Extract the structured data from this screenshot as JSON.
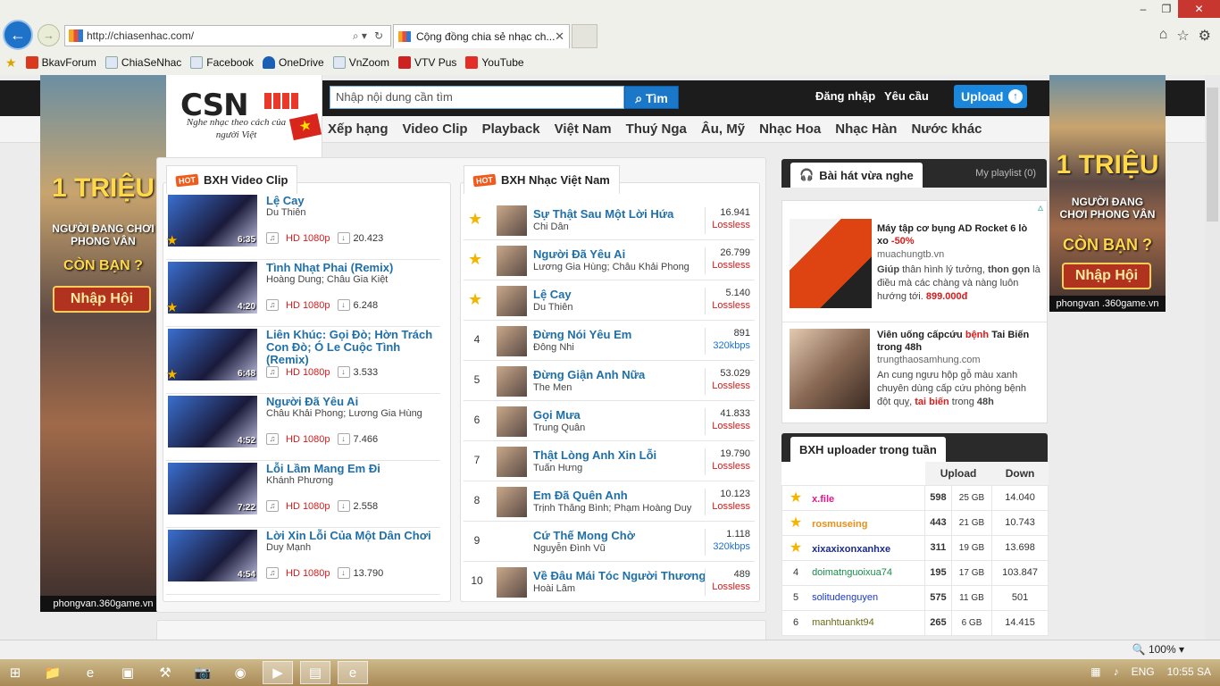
{
  "browser": {
    "url": "http://chiasenhac.com/",
    "tab_title": "Cộng đồng chia sẻ nhạc ch...",
    "favorites": [
      "BkavForum",
      "ChiaSeNhac",
      "Facebook",
      "OneDrive",
      "VnZoom",
      "VTV Pus",
      "YouTube"
    ],
    "zoom": "100%"
  },
  "site": {
    "logo": "CSN",
    "slogan": "Nghe nhạc theo cách của người Việt",
    "search_placeholder": "Nhập nội dung cần tìm",
    "search_button": "Tìm",
    "login": "Đăng nhập",
    "request": "Yêu cầu",
    "upload": "Upload",
    "menu": [
      "Xếp hạng",
      "Video Clip",
      "Playback",
      "Việt Nam",
      "Thuý Nga",
      "Âu, Mỹ",
      "Nhạc Hoa",
      "Nhạc Hàn",
      "Nước khác"
    ]
  },
  "ads": {
    "left": {
      "top": "1 TRIỆU",
      "mid": "NGƯỜI ĐANG CHƠI PHONG VÂN",
      "ask": "CÒN BẠN ?",
      "btn": "Nhập Hội",
      "foot": "phongvan.360game.vn"
    },
    "right": {
      "top": "1 TRIỆU",
      "mid": "NGƯỜI ĐANG CHƠI PHONG VÂN",
      "ask": "CÒN BẠN ?",
      "btn": "Nhập Hội",
      "foot": "phongvan .360game.vn"
    }
  },
  "video_chart": {
    "title": "BXH Video Clip",
    "hot": "HOT",
    "items": [
      {
        "title": "Lệ Cay",
        "artist": "Du Thiên",
        "duration": "6:35",
        "quality": "HD 1080p",
        "views": "20.423",
        "rank": "1"
      },
      {
        "title": "Tình Nhạt Phai (Remix)",
        "artist": "Hoàng Dung; Châu Gia Kiệt",
        "duration": "4:20",
        "quality": "HD 1080p",
        "views": "6.248",
        "rank": "2"
      },
      {
        "title": "Liên Khúc: Gọi Đò; Hờn Trách Con Đò; Ó Le Cuộc Tình (Remix)",
        "artist": "",
        "duration": "6:48",
        "quality": "HD 1080p",
        "views": "3.533",
        "rank": "3"
      },
      {
        "title": "Người Đã Yêu Ai",
        "artist": "Châu Khải Phong; Lương Gia Hùng",
        "duration": "4:52",
        "quality": "HD 1080p",
        "views": "7.466",
        "rank": ""
      },
      {
        "title": "Lỗi Lầm Mang Em Đi",
        "artist": "Khánh Phương",
        "duration": "7:22",
        "quality": "HD 1080p",
        "views": "2.558",
        "rank": ""
      },
      {
        "title": "Lời Xin Lỗi Của Một Dân Chơi",
        "artist": "Duy Mạnh",
        "duration": "4:54",
        "quality": "HD 1080p",
        "views": "13.790",
        "rank": ""
      }
    ]
  },
  "vn_chart": {
    "title": "BXH Nhạc Việt Nam",
    "hot": "HOT",
    "items": [
      {
        "rank": "1",
        "title": "Sự Thật Sau Một Lời Hứa",
        "artist": "Chi Dân",
        "count": "16.941",
        "quality": "Lossless"
      },
      {
        "rank": "2",
        "title": "Người Đã Yêu Ai",
        "artist": "Lương Gia Hùng; Châu Khải Phong",
        "count": "26.799",
        "quality": "Lossless"
      },
      {
        "rank": "3",
        "title": "Lệ Cay",
        "artist": "Du Thiên",
        "count": "5.140",
        "quality": "Lossless"
      },
      {
        "rank": "4",
        "title": "Đừng Nói Yêu Em",
        "artist": "Đông Nhi",
        "count": "891",
        "quality": "320kbps"
      },
      {
        "rank": "5",
        "title": "Đừng Giận Anh Nữa",
        "artist": "The Men",
        "count": "53.029",
        "quality": "Lossless"
      },
      {
        "rank": "6",
        "title": "Gọi Mưa",
        "artist": "Trung Quân",
        "count": "41.833",
        "quality": "Lossless"
      },
      {
        "rank": "7",
        "title": "Thật Lòng Anh Xin Lỗi",
        "artist": "Tuấn Hưng",
        "count": "19.790",
        "quality": "Lossless"
      },
      {
        "rank": "8",
        "title": "Em Đã Quên Anh",
        "artist": "Trịnh Thăng Bình; Phạm Hoàng Duy",
        "count": "10.123",
        "quality": "Lossless"
      },
      {
        "rank": "9",
        "title": "Cứ Thế Mong Chờ",
        "artist": "Nguyễn Đình Vũ",
        "count": "1.118",
        "quality": "320kbps"
      },
      {
        "rank": "10",
        "title": "Về Đâu Mái Tóc Người Thương",
        "artist": "Hoài Lâm",
        "count": "489",
        "quality": "Lossless"
      }
    ]
  },
  "recent": {
    "title": "Bài hát vừa nghe",
    "playlist": "My playlist (0)"
  },
  "promos": [
    {
      "title": "Máy tập cơ bụng AD Rocket 6 lò xo",
      "discount": "-50%",
      "site": "muachungtb.vn",
      "desc_a": "Giúp",
      "desc_b": "thân hình lý tưởng,",
      "desc_c": "thon gọn",
      "desc_d": "là điều mà các chàng và nàng luôn hướng tới.",
      "price": "899.000đ"
    },
    {
      "title_a": "Viên uống cấpcứu",
      "title_b": "bệnh",
      "title_c": "Tai Biến trong 48h",
      "site": "trungthaosamhung.com",
      "desc": "An cung ngưu hộp gỗ màu xanh chuyên dùng cấp cứu phòng bệnh đột quỵ,",
      "tail": "tai biến",
      "tail2": "trong",
      "tail3": "48h"
    }
  ],
  "uploaders": {
    "title": "BXH uploader trong tuần",
    "cols": [
      "Upload",
      "Down"
    ],
    "rows": [
      {
        "rank": "1",
        "name": "x.file",
        "up": "598",
        "size": "25 GB",
        "down": "14.040",
        "color": "#e0188c"
      },
      {
        "rank": "2",
        "name": "rosmuseing",
        "up": "443",
        "size": "21 GB",
        "down": "10.743",
        "color": "#e8901b"
      },
      {
        "rank": "3",
        "name": "xixaxixonxanhxe",
        "up": "311",
        "size": "19 GB",
        "down": "13.698",
        "color": "#1a2a8c"
      },
      {
        "rank": "4",
        "name": "doimatnguoixua74",
        "up": "195",
        "size": "17 GB",
        "down": "103.847",
        "color": "#1a8c4a"
      },
      {
        "rank": "5",
        "name": "solitudenguyen",
        "up": "575",
        "size": "11 GB",
        "down": "501",
        "color": "#1a3ad0"
      },
      {
        "rank": "6",
        "name": "manhtuankt94",
        "up": "265",
        "size": "6 GB",
        "down": "14.415",
        "color": "#6a6a1a"
      }
    ]
  },
  "taskbar": {
    "lang": "ENG",
    "time": "10:55 SA"
  }
}
